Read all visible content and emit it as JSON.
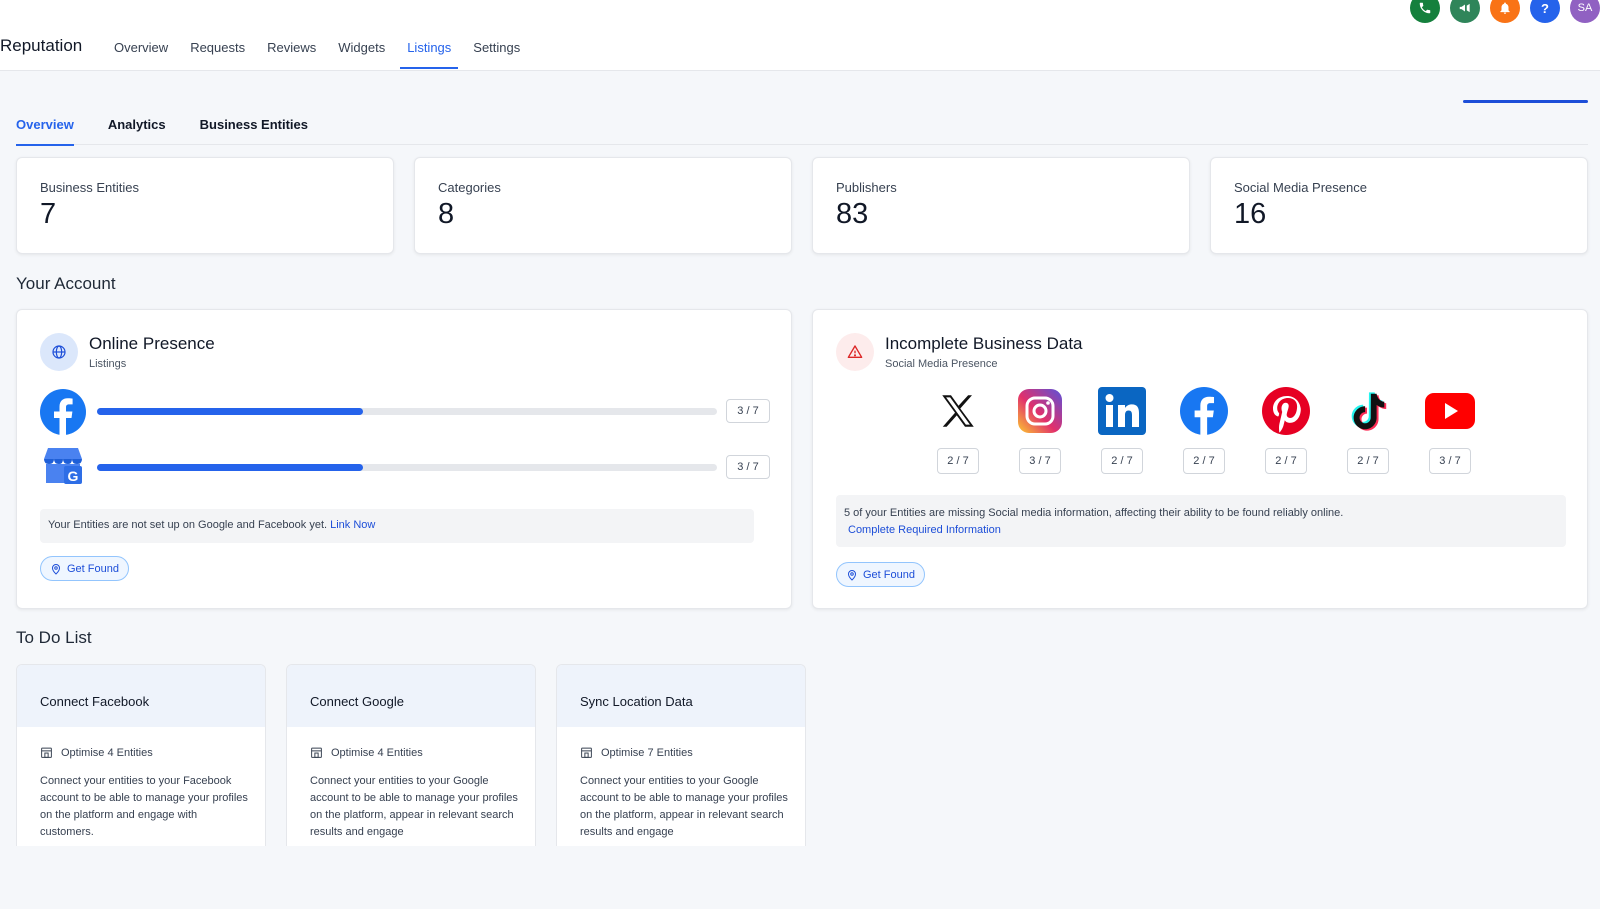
{
  "app": {
    "title": "Reputation"
  },
  "main_nav": [
    {
      "label": "Overview"
    },
    {
      "label": "Requests"
    },
    {
      "label": "Reviews"
    },
    {
      "label": "Widgets"
    },
    {
      "label": "Listings",
      "active": true
    },
    {
      "label": "Settings"
    }
  ],
  "top_icons": [
    {
      "name": "phone-icon",
      "color": "#15803d"
    },
    {
      "name": "megaphone-icon",
      "color": "#2f855a"
    },
    {
      "name": "bell-icon",
      "color": "#f97316"
    },
    {
      "name": "help-icon",
      "color": "#2563eb"
    },
    {
      "name": "avatar",
      "color": "#9061c2",
      "label": "SA"
    }
  ],
  "subtabs": [
    {
      "label": "Overview",
      "active": true
    },
    {
      "label": "Analytics"
    },
    {
      "label": "Business Entities"
    }
  ],
  "stats": [
    {
      "label": "Business Entities",
      "value": "7"
    },
    {
      "label": "Categories",
      "value": "8"
    },
    {
      "label": "Publishers",
      "value": "83"
    },
    {
      "label": "Social Media Presence",
      "value": "16"
    }
  ],
  "your_account": {
    "title": "Your Account"
  },
  "online_presence": {
    "title": "Online Presence",
    "subtitle": "Listings",
    "rows": [
      {
        "platform": "facebook-logo",
        "count": "3 / 7",
        "fraction": 0.4286
      },
      {
        "platform": "google-business-logo",
        "count": "3 / 7",
        "fraction": 0.4286
      }
    ],
    "notice_text": "Your Entities are not set up on Google and Facebook yet.",
    "notice_link": "Link Now",
    "button": "Get Found"
  },
  "incomplete_data": {
    "title": "Incomplete Business Data",
    "subtitle": "Social Media Presence",
    "platforms": [
      {
        "name": "x-logo",
        "count": "2 / 7"
      },
      {
        "name": "instagram-logo",
        "count": "3 / 7"
      },
      {
        "name": "linkedin-logo",
        "count": "2 / 7"
      },
      {
        "name": "facebook-logo",
        "count": "2 / 7"
      },
      {
        "name": "pinterest-logo",
        "count": "2 / 7"
      },
      {
        "name": "tiktok-logo",
        "count": "2 / 7"
      },
      {
        "name": "youtube-logo",
        "count": "3 / 7"
      }
    ],
    "notice_text": "5 of your Entities are missing Social media information, affecting their ability to be found reliably online.",
    "notice_link": "Complete Required Information",
    "button": "Get Found"
  },
  "todo": {
    "title": "To Do List",
    "cards": [
      {
        "title": "Connect Facebook",
        "meta": "Optimise 4 Entities",
        "desc": "Connect your entities to your Facebook account to be able to manage your profiles on the platform and engage with customers."
      },
      {
        "title": "Connect Google",
        "meta": "Optimise 4 Entities",
        "desc": "Connect your entities to your Google account to be able to manage your profiles on the platform, appear in relevant search results and engage"
      },
      {
        "title": "Sync Location Data",
        "meta": "Optimise 7 Entities",
        "desc": "Connect your entities to your Google account to be able to manage your profiles on the platform, appear in relevant search results and engage"
      }
    ]
  }
}
